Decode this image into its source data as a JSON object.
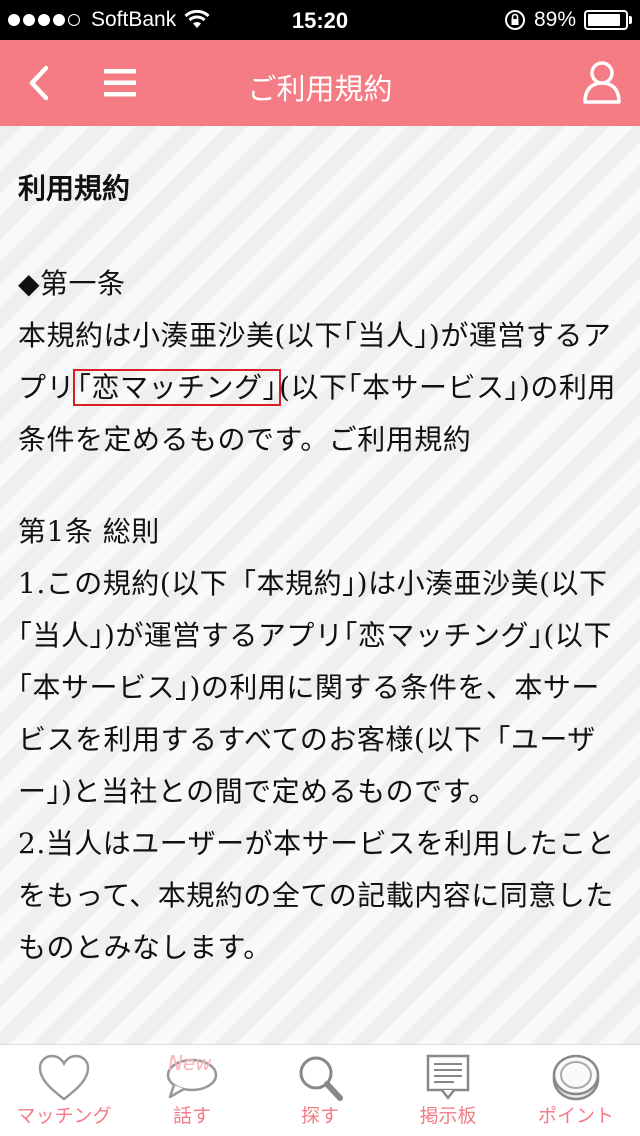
{
  "status_bar": {
    "carrier": "SoftBank",
    "time": "15:20",
    "battery_percent": "89%",
    "battery_level": 0.89,
    "signal_bars_filled": 4,
    "signal_bars_total": 5
  },
  "nav": {
    "title": "ご利用規約",
    "back_icon": "chevron-left-icon",
    "menu_icon": "hamburger-menu-icon",
    "user_icon": "user-icon"
  },
  "content": {
    "heading": "利用規約",
    "article_title": "◆第一条",
    "intro_before": "本規約は小湊亜沙美(以下｢当人｣)が運営するアプリ",
    "intro_highlight": "｢恋マッチング｣",
    "intro_after": "(以下｢本サービス｣)の利用条件を定めるものです。ご利用規約",
    "section_title": "第1条 総則",
    "clause_1": "1.この規約(以下「本規約」)は小湊亜沙美(以下｢当人｣)が運営するアプリ｢恋マッチング｣(以下｢本サービス｣)の利用に関する条件を、本サービスを利用するすべてのお客様(以下「ユーザー」)と当社との間で定めるものです。",
    "clause_2": "2.当人はユーザーが本サービスを利用したことをもって、本規約の全ての記載内容に同意したものとみなします。"
  },
  "tabs": [
    {
      "label": "マッチング",
      "icon": "heart-icon"
    },
    {
      "label": "話す",
      "icon": "speech-bubble-icon",
      "badge": "New"
    },
    {
      "label": "探す",
      "icon": "search-icon"
    },
    {
      "label": "掲示板",
      "icon": "bulletin-board-icon"
    },
    {
      "label": "ポイント",
      "icon": "coin-icon"
    }
  ],
  "colors": {
    "accent": "#f57c85",
    "highlight_border": "#d81e26"
  }
}
